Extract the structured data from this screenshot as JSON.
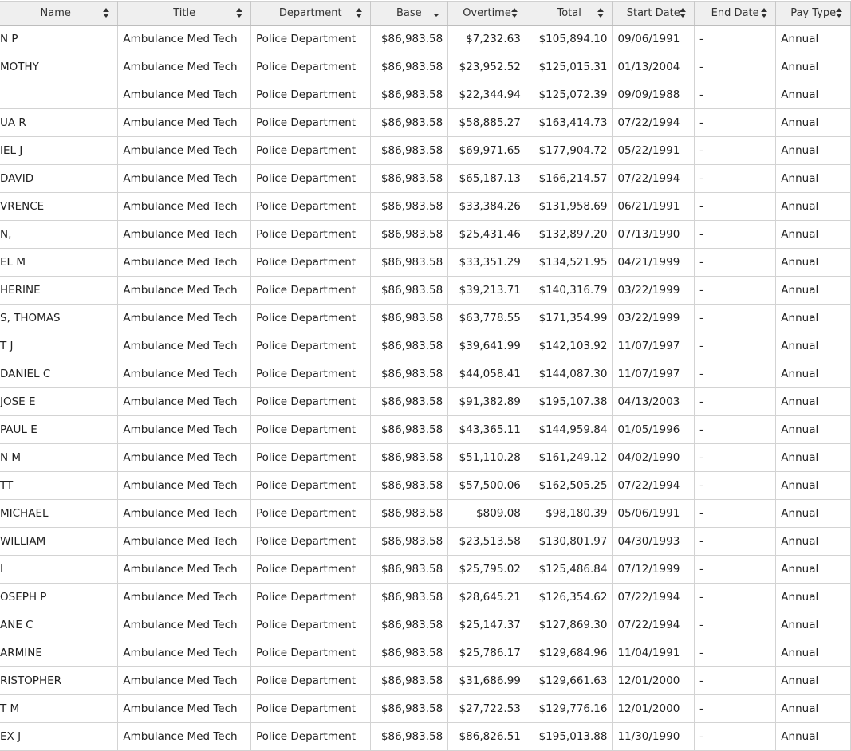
{
  "columns": [
    {
      "key": "name",
      "label": "Name",
      "sort": "both"
    },
    {
      "key": "title",
      "label": "Title",
      "sort": "both"
    },
    {
      "key": "department",
      "label": "Department",
      "sort": "both"
    },
    {
      "key": "base",
      "label": "Base",
      "sort": "desc"
    },
    {
      "key": "overtime",
      "label": "Overtime",
      "sort": "both"
    },
    {
      "key": "total",
      "label": "Total",
      "sort": "both"
    },
    {
      "key": "start_date",
      "label": "Start Date",
      "sort": "both"
    },
    {
      "key": "end_date",
      "label": "End Date",
      "sort": "both"
    },
    {
      "key": "pay_type",
      "label": "Pay Type",
      "sort": "both"
    }
  ],
  "rows": [
    {
      "name": "N P",
      "title": "Ambulance Med Tech",
      "department": "Police Department",
      "base": "$86,983.58",
      "overtime": "$7,232.63",
      "total": "$105,894.10",
      "start_date": "09/06/1991",
      "end_date": "-",
      "pay_type": "Annual"
    },
    {
      "name": "MOTHY",
      "title": "Ambulance Med Tech",
      "department": "Police Department",
      "base": "$86,983.58",
      "overtime": "$23,952.52",
      "total": "$125,015.31",
      "start_date": "01/13/2004",
      "end_date": "-",
      "pay_type": "Annual"
    },
    {
      "name": "",
      "title": "Ambulance Med Tech",
      "department": "Police Department",
      "base": "$86,983.58",
      "overtime": "$22,344.94",
      "total": "$125,072.39",
      "start_date": "09/09/1988",
      "end_date": "-",
      "pay_type": "Annual"
    },
    {
      "name": "UA R",
      "title": "Ambulance Med Tech",
      "department": "Police Department",
      "base": "$86,983.58",
      "overtime": "$58,885.27",
      "total": "$163,414.73",
      "start_date": "07/22/1994",
      "end_date": "-",
      "pay_type": "Annual"
    },
    {
      "name": "IEL J",
      "title": "Ambulance Med Tech",
      "department": "Police Department",
      "base": "$86,983.58",
      "overtime": "$69,971.65",
      "total": "$177,904.72",
      "start_date": "05/22/1991",
      "end_date": "-",
      "pay_type": "Annual"
    },
    {
      "name": "DAVID",
      "title": "Ambulance Med Tech",
      "department": "Police Department",
      "base": "$86,983.58",
      "overtime": "$65,187.13",
      "total": "$166,214.57",
      "start_date": "07/22/1994",
      "end_date": "-",
      "pay_type": "Annual"
    },
    {
      "name": "VRENCE",
      "title": "Ambulance Med Tech",
      "department": "Police Department",
      "base": "$86,983.58",
      "overtime": "$33,384.26",
      "total": "$131,958.69",
      "start_date": "06/21/1991",
      "end_date": "-",
      "pay_type": "Annual"
    },
    {
      "name": "N,",
      "title": "Ambulance Med Tech",
      "department": "Police Department",
      "base": "$86,983.58",
      "overtime": "$25,431.46",
      "total": "$132,897.20",
      "start_date": "07/13/1990",
      "end_date": "-",
      "pay_type": "Annual"
    },
    {
      "name": "EL M",
      "title": "Ambulance Med Tech",
      "department": "Police Department",
      "base": "$86,983.58",
      "overtime": "$33,351.29",
      "total": "$134,521.95",
      "start_date": "04/21/1999",
      "end_date": "-",
      "pay_type": "Annual"
    },
    {
      "name": "HERINE",
      "title": "Ambulance Med Tech",
      "department": "Police Department",
      "base": "$86,983.58",
      "overtime": "$39,213.71",
      "total": "$140,316.79",
      "start_date": "03/22/1999",
      "end_date": "-",
      "pay_type": "Annual"
    },
    {
      "name": "S, THOMAS",
      "title": "Ambulance Med Tech",
      "department": "Police Department",
      "base": "$86,983.58",
      "overtime": "$63,778.55",
      "total": "$171,354.99",
      "start_date": "03/22/1999",
      "end_date": "-",
      "pay_type": "Annual"
    },
    {
      "name": "T J",
      "title": "Ambulance Med Tech",
      "department": "Police Department",
      "base": "$86,983.58",
      "overtime": "$39,641.99",
      "total": "$142,103.92",
      "start_date": "11/07/1997",
      "end_date": "-",
      "pay_type": "Annual"
    },
    {
      "name": "DANIEL C",
      "title": "Ambulance Med Tech",
      "department": "Police Department",
      "base": "$86,983.58",
      "overtime": "$44,058.41",
      "total": "$144,087.30",
      "start_date": "11/07/1997",
      "end_date": "-",
      "pay_type": "Annual"
    },
    {
      "name": "JOSE E",
      "title": "Ambulance Med Tech",
      "department": "Police Department",
      "base": "$86,983.58",
      "overtime": "$91,382.89",
      "total": "$195,107.38",
      "start_date": "04/13/2003",
      "end_date": "-",
      "pay_type": "Annual"
    },
    {
      "name": "PAUL E",
      "title": "Ambulance Med Tech",
      "department": "Police Department",
      "base": "$86,983.58",
      "overtime": "$43,365.11",
      "total": "$144,959.84",
      "start_date": "01/05/1996",
      "end_date": "-",
      "pay_type": "Annual"
    },
    {
      "name": "N M",
      "title": "Ambulance Med Tech",
      "department": "Police Department",
      "base": "$86,983.58",
      "overtime": "$51,110.28",
      "total": "$161,249.12",
      "start_date": "04/02/1990",
      "end_date": "-",
      "pay_type": "Annual"
    },
    {
      "name": "TT",
      "title": "Ambulance Med Tech",
      "department": "Police Department",
      "base": "$86,983.58",
      "overtime": "$57,500.06",
      "total": "$162,505.25",
      "start_date": "07/22/1994",
      "end_date": "-",
      "pay_type": "Annual"
    },
    {
      "name": "MICHAEL",
      "title": "Ambulance Med Tech",
      "department": "Police Department",
      "base": "$86,983.58",
      "overtime": "$809.08",
      "total": "$98,180.39",
      "start_date": "05/06/1991",
      "end_date": "-",
      "pay_type": "Annual"
    },
    {
      "name": "WILLIAM",
      "title": "Ambulance Med Tech",
      "department": "Police Department",
      "base": "$86,983.58",
      "overtime": "$23,513.58",
      "total": "$130,801.97",
      "start_date": "04/30/1993",
      "end_date": "-",
      "pay_type": "Annual"
    },
    {
      "name": "I",
      "title": "Ambulance Med Tech",
      "department": "Police Department",
      "base": "$86,983.58",
      "overtime": "$25,795.02",
      "total": "$125,486.84",
      "start_date": "07/12/1999",
      "end_date": "-",
      "pay_type": "Annual"
    },
    {
      "name": "OSEPH P",
      "title": "Ambulance Med Tech",
      "department": "Police Department",
      "base": "$86,983.58",
      "overtime": "$28,645.21",
      "total": "$126,354.62",
      "start_date": "07/22/1994",
      "end_date": "-",
      "pay_type": "Annual"
    },
    {
      "name": "ANE C",
      "title": "Ambulance Med Tech",
      "department": "Police Department",
      "base": "$86,983.58",
      "overtime": "$25,147.37",
      "total": "$127,869.30",
      "start_date": "07/22/1994",
      "end_date": "-",
      "pay_type": "Annual"
    },
    {
      "name": "ARMINE",
      "title": "Ambulance Med Tech",
      "department": "Police Department",
      "base": "$86,983.58",
      "overtime": "$25,786.17",
      "total": "$129,684.96",
      "start_date": "11/04/1991",
      "end_date": "-",
      "pay_type": "Annual"
    },
    {
      "name": "RISTOPHER",
      "title": "Ambulance Med Tech",
      "department": "Police Department",
      "base": "$86,983.58",
      "overtime": "$31,686.99",
      "total": "$129,661.63",
      "start_date": "12/01/2000",
      "end_date": "-",
      "pay_type": "Annual"
    },
    {
      "name": "T M",
      "title": "Ambulance Med Tech",
      "department": "Police Department",
      "base": "$86,983.58",
      "overtime": "$27,722.53",
      "total": "$129,776.16",
      "start_date": "12/01/2000",
      "end_date": "-",
      "pay_type": "Annual"
    },
    {
      "name": "EX J",
      "title": "Ambulance Med Tech",
      "department": "Police Department",
      "base": "$86,983.58",
      "overtime": "$86,826.51",
      "total": "$195,013.88",
      "start_date": "11/30/1990",
      "end_date": "-",
      "pay_type": "Annual"
    }
  ]
}
